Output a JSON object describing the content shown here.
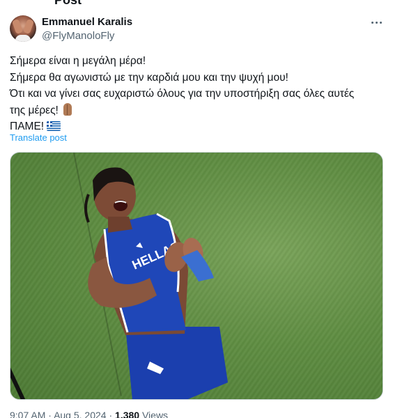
{
  "header_fragment": "Post",
  "author": {
    "name": "Emmanuel Karalis",
    "handle": "@FlyManoloFly"
  },
  "tweet": {
    "lines": [
      "Σήμερα είναι η μεγάλη μέρα!",
      "Σήμερα θα αγωνιστώ με την καρδιά μου και την ψυχή μου!",
      "Ότι και να γίνει σας ευχαριστώ όλους για την υποστήριξη σας όλες αυτές",
      "της μέρες!",
      "ΠΑΜΕ!"
    ],
    "emoji_after_line_4": "folded-hands-emoji",
    "emoji_after_line_5": "greece-flag-emoji",
    "translate_label": "Translate post"
  },
  "media": {
    "jersey_text": "HELLAS",
    "colors": {
      "jersey": "#1f47b8",
      "grass": "#5f8d42"
    }
  },
  "footer": {
    "time": "9:07 AM",
    "separator": "·",
    "date": "Aug 5, 2024",
    "views_count": "1,380",
    "views_label": "Views"
  },
  "icons": {
    "more": "more-horizontal-icon"
  }
}
